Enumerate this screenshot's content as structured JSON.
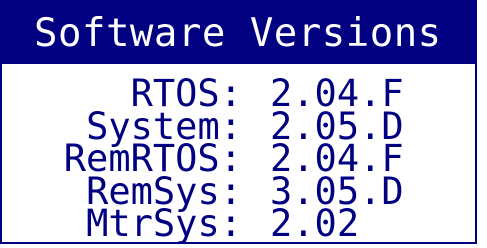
{
  "window": {
    "title": "Software Versions"
  },
  "versions": [
    {
      "label": "RTOS:",
      "value": "2.04.F"
    },
    {
      "label": "System:",
      "value": "2.05.D"
    },
    {
      "label": "RemRTOS:",
      "value": "2.04.F"
    },
    {
      "label": "RemSys:",
      "value": "3.05.D"
    },
    {
      "label": "MtrSys:",
      "value": "2.02"
    }
  ],
  "colors": {
    "title_bg": "#000080",
    "title_text": "#ffffff",
    "body_text": "#000080",
    "body_bg": "#ffffff"
  }
}
